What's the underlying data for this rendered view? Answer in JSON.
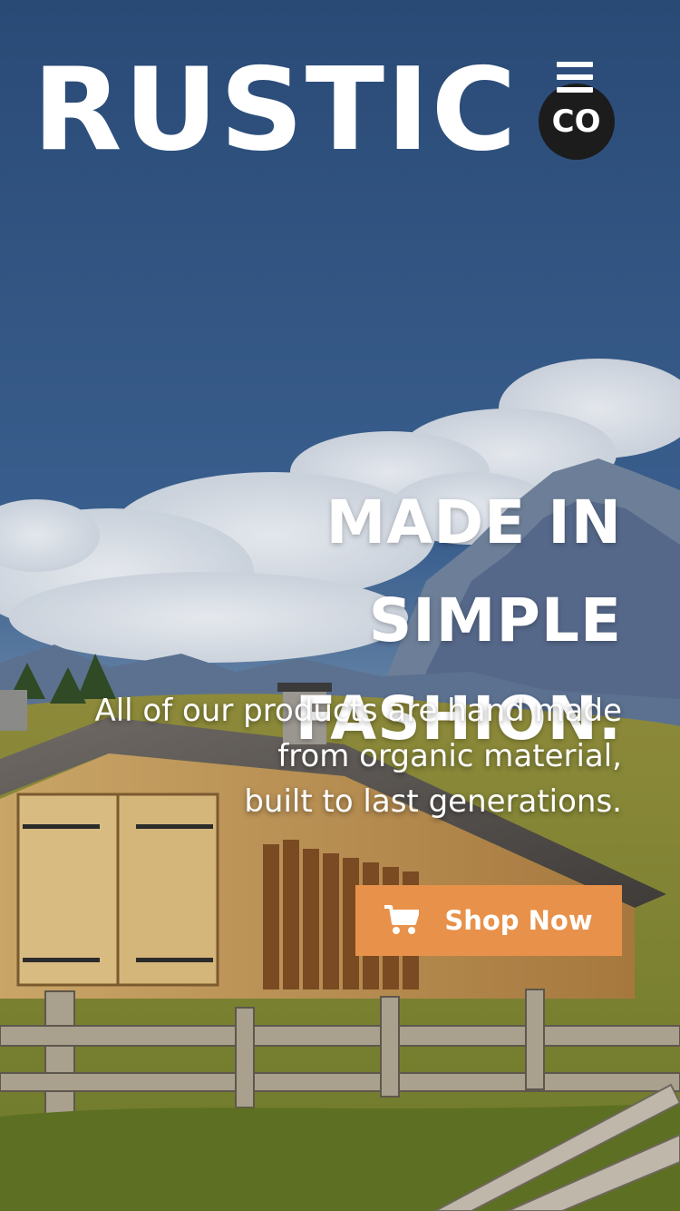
{
  "brand": {
    "name": "RUSTIC",
    "badge": "CO"
  },
  "nav": {
    "menu_icon": "hamburger-icon"
  },
  "hero": {
    "headline_lines": [
      "MADE IN SIMPLE",
      "FASHION."
    ],
    "subtext_lines": [
      "All of our products are hand made",
      "from organic material,",
      "built to last generations."
    ],
    "cta": {
      "label": "Shop Now",
      "icon": "cart-icon"
    }
  },
  "colors": {
    "accent": "#e8914a",
    "badge_bg": "#1c1c1c",
    "text": "#ffffff"
  }
}
